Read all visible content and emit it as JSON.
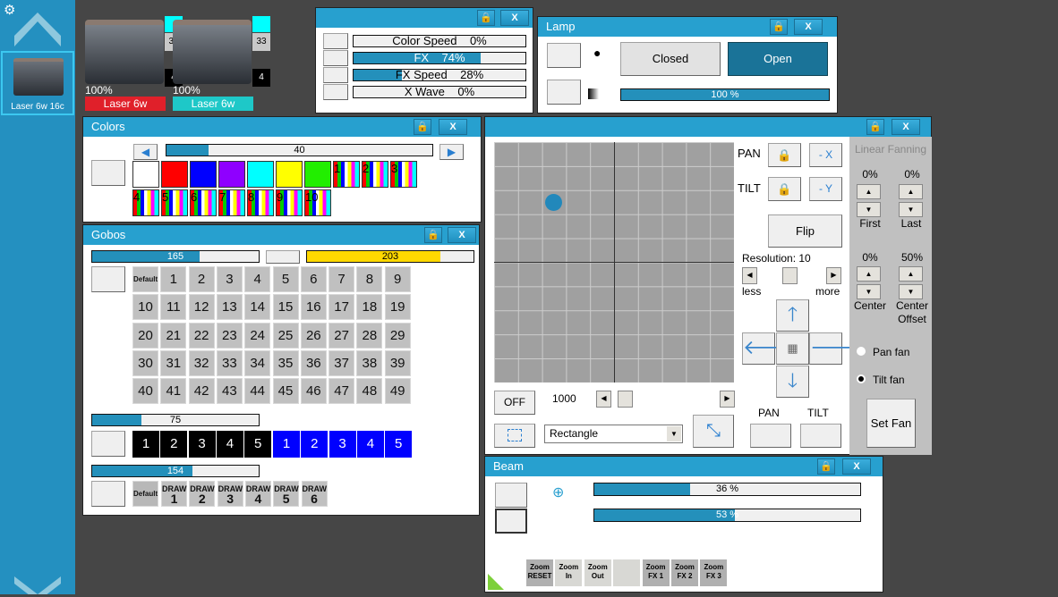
{
  "sidebar": {
    "fixture_label": "Laser 6w 16c"
  },
  "fixtures": [
    {
      "name": "Laser 6w",
      "percent": "100%",
      "badge_top": "33",
      "badge_bottom": "4",
      "label_color": "#e0202a"
    },
    {
      "name": "Laser 6w",
      "percent": "100%",
      "badge_top": "33",
      "badge_bottom": "4",
      "label_color": "#1ec8c8"
    }
  ],
  "fx": {
    "rows": [
      {
        "label": "Color Speed",
        "value": "0%",
        "fill": 0
      },
      {
        "label": "FX",
        "value": "74%",
        "fill": 0.74
      },
      {
        "label": "FX Speed",
        "value": "28%",
        "fill": 0.28
      },
      {
        "label": "X Wave",
        "value": "0%",
        "fill": 0
      }
    ]
  },
  "lamp": {
    "title": "Lamp",
    "closed": "Closed",
    "open": "Open",
    "dimmer": "100 %",
    "dimmer_fill": 1.0
  },
  "colors": {
    "title": "Colors",
    "slider": "40",
    "slider_fill": 0.157,
    "swatches": [
      "#ffffff",
      "#ff0000",
      "#0000ff",
      "#8f00ff",
      "#00ffff",
      "#ffff00",
      "#22ee00"
    ],
    "wheels": [
      "1",
      "2",
      "3",
      "4",
      "5",
      "6",
      "7",
      "8",
      "9",
      "10"
    ]
  },
  "gobos": {
    "title": "Gobos",
    "slider1": "165",
    "slider1_fill": 0.647,
    "slider2": "203",
    "slider2_fill": 0.8,
    "default": "Default",
    "grid": [
      "1",
      "2",
      "3",
      "4",
      "5",
      "6",
      "7",
      "8",
      "9",
      "10",
      "11",
      "12",
      "13",
      "14",
      "15",
      "16",
      "17",
      "18",
      "19",
      "20",
      "21",
      "22",
      "23",
      "24",
      "25",
      "26",
      "27",
      "28",
      "29",
      "30",
      "31",
      "32",
      "33",
      "34",
      "35",
      "36",
      "37",
      "38",
      "39",
      "40",
      "41",
      "42",
      "43",
      "44",
      "45",
      "46",
      "47",
      "48",
      "49"
    ],
    "slider3": "75",
    "slider3_fill": 0.294,
    "rot_black": [
      "1",
      "2",
      "3",
      "4",
      "5"
    ],
    "rot_blue": [
      "1",
      "2",
      "3",
      "4",
      "5"
    ],
    "slider4": "154",
    "slider4_fill": 0.604,
    "draw_word": "DRAW",
    "draw": [
      "1",
      "2",
      "3",
      "4",
      "5",
      "6"
    ]
  },
  "position": {
    "pan": "PAN",
    "tilt": "TILT",
    "minus_x": "- X",
    "minus_y": "- Y",
    "flip": "Flip",
    "resolution": "Resolution: 10",
    "less": "less",
    "more": "more",
    "off": "OFF",
    "speed": "1000",
    "shape": "Rectangle",
    "pan_bottom": "PAN",
    "tilt_bottom": "TILT",
    "fanning": {
      "title": "Linear Fanning",
      "first_val": "0%",
      "last_val": "0%",
      "first": "First",
      "last": "Last",
      "center_val": "0%",
      "offset_val": "50%",
      "center": "Center",
      "offset": "Center Offset",
      "pan_fan": "Pan fan",
      "tilt_fan": "Tilt fan",
      "set_fan": "Set Fan"
    }
  },
  "beam": {
    "title": "Beam",
    "bar1": "36 %",
    "bar1_fill": 0.36,
    "bar2": "53 %",
    "bar2_fill": 0.53,
    "zoom_buttons": [
      "Zoom RESET",
      "Zoom In",
      "Zoom Out",
      "",
      "Zoom FX 1",
      "Zoom FX 2",
      "Zoom FX 3"
    ]
  },
  "colors_theme": {
    "accent": "#27a0cf",
    "sidebar": "#2490c0"
  }
}
